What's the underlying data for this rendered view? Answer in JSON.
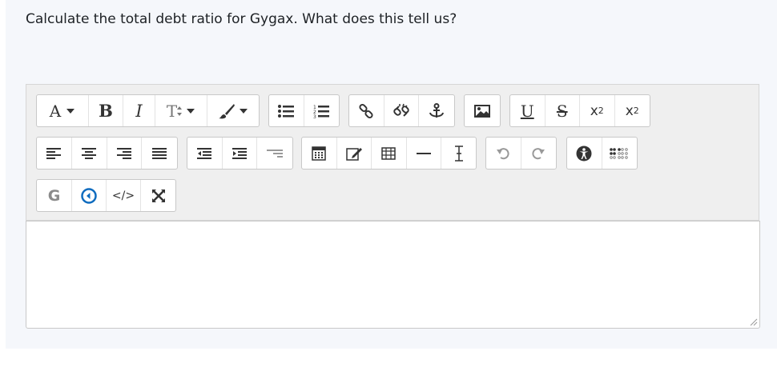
{
  "question": {
    "text": "Calculate the total debt ratio for Gygax.  What does this tell us?"
  },
  "toolbar": {
    "font_size_label": "A",
    "bold_label": "B",
    "italic_label": "I",
    "style_label": "T",
    "underline_label": "U",
    "strike_label": "S",
    "subscript_base": "x",
    "subscript_label": "2",
    "superscript_base": "x",
    "superscript_label": "2",
    "html_label": "</>",
    "g_label": "G"
  },
  "colors": {
    "accent": "#0f6cbf",
    "border": "#c8c8c8",
    "toolbar_bg": "#efefef",
    "panel_bg": "#f5f7fb"
  }
}
